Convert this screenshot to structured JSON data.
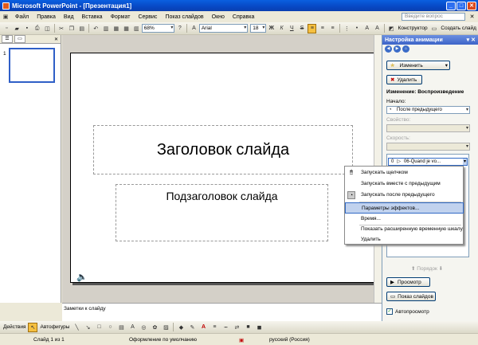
{
  "window": {
    "title": "Microsoft PowerPoint - [Презентация1]"
  },
  "menu": {
    "items": [
      "Файл",
      "Правка",
      "Вид",
      "Вставка",
      "Формат",
      "Сервис",
      "Показ слайдов",
      "Окно",
      "Справка"
    ],
    "ask_placeholder": "Введите вопрос"
  },
  "toolbar": {
    "zoom": "68%",
    "font": "Arial",
    "font_size": "18",
    "bold": "Ж",
    "italic": "К",
    "underline": "Ч",
    "shadow": "S",
    "designer": "Конструктор",
    "new_slide": "Создать слайд"
  },
  "left_pane": {
    "slide_number": "1"
  },
  "slide": {
    "title_placeholder": "Заголовок слайда",
    "subtitle_placeholder": "Подзаголовок слайда"
  },
  "notes": {
    "placeholder": "Заметки к слайду"
  },
  "task_pane": {
    "title": "Настройка анимации",
    "change_button": "Изменить",
    "remove_button": "Удалить",
    "change_section": "Изменение: Воспроизведение",
    "start_label": "Начало:",
    "start_value": "После предыдущего",
    "property_label": "Свойство:",
    "speed_label": "Скорость:",
    "anim_item_number": "0",
    "anim_item_name": "06-Quand je vo...",
    "reorder_label": "Порядок",
    "preview_button": "Просмотр",
    "slideshow_button": "Показ слайдов",
    "autopreview_label": "Автопросмотр"
  },
  "context_menu": {
    "items": [
      "Запускать щелчком",
      "Запускать вместе с предыдущим",
      "Запускать после предыдущего",
      "Параметры эффектов...",
      "Время...",
      "Показать расширенную временную шкалу",
      "Удалить"
    ]
  },
  "drawbar": {
    "actions": "Действия",
    "autoshapes": "Автофигуры"
  },
  "status": {
    "slide": "Слайд 1 из 1",
    "design": "Оформление по умолчанию",
    "language": "русский (Россия)"
  }
}
